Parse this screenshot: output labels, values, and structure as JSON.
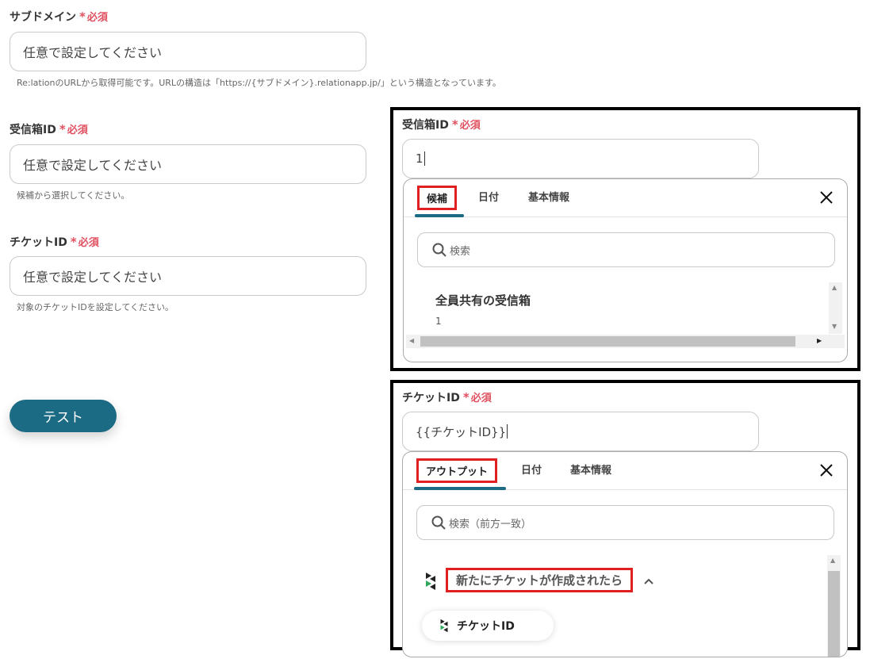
{
  "subdomain": {
    "label": "サブドメイン",
    "required": "必須",
    "placeholder": "任意で設定してください",
    "hint": "Re:lationのURLから取得可能です。URLの構造は「https://{サブドメイン}.relationapp.jp/」という構造となっています。"
  },
  "inbox": {
    "label": "受信箱ID",
    "required": "必須",
    "placeholder": "任意で設定してください",
    "hint": "候補から選択してください。"
  },
  "ticket": {
    "label": "チケットID",
    "required": "必須",
    "placeholder": "任意で設定してください",
    "hint": "対象のチケットIDを設定してください。"
  },
  "test_button": "テスト",
  "panel1": {
    "label": "受信箱ID",
    "required": "必須",
    "value": "1",
    "tabs": [
      "候補",
      "日付",
      "基本情報"
    ],
    "search_placeholder": "検索",
    "item_title": "全員共有の受信箱",
    "item_value": "1"
  },
  "panel2": {
    "label": "チケットID",
    "required": "必須",
    "value": "{{チケットID}}",
    "tabs": [
      "アウトプット",
      "日付",
      "基本情報"
    ],
    "search_placeholder": "検索（前方一致）",
    "group_title": "新たにチケットが作成されたら",
    "chip_label": "チケットID"
  },
  "colors": {
    "accent": "#1c6b84",
    "required": "#e05060",
    "highlight": "#e02020"
  },
  "icons": [
    "search-icon",
    "close-icon",
    "chevron-up-icon",
    "app-logo-icon"
  ]
}
